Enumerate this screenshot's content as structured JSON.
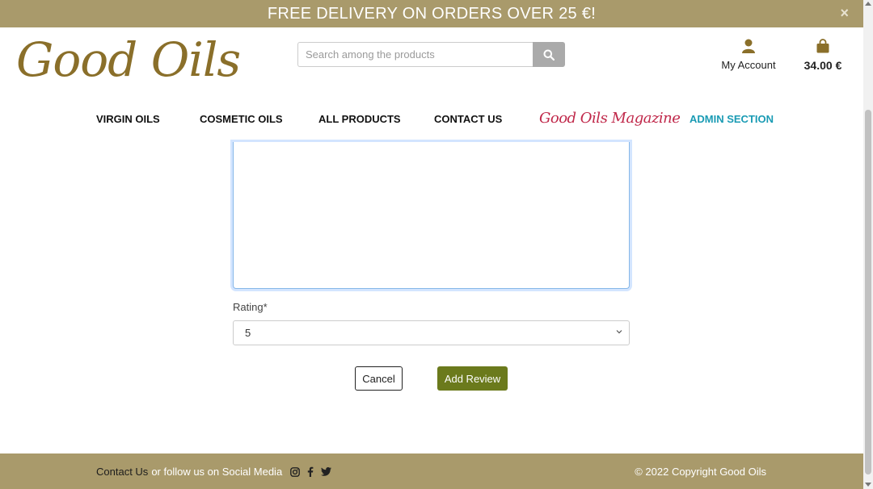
{
  "banner": {
    "text": "FREE DELIVERY ON ORDERS OVER 25 €!",
    "close_icon": "×"
  },
  "header": {
    "logo_text": "Good Oils",
    "search": {
      "placeholder": "Search among the products",
      "value": "",
      "button_icon": "search-icon"
    },
    "account": {
      "label": "My Account",
      "icon": "user-icon"
    },
    "cart": {
      "total": "34.00 €",
      "icon": "shopping-bag-icon"
    }
  },
  "nav": {
    "items": [
      {
        "label": "VIRGIN OILS"
      },
      {
        "label": "COSMETIC OILS"
      },
      {
        "label": "ALL PRODUCTS"
      },
      {
        "label": "CONTACT US"
      },
      {
        "label": "Good Oils Magazine"
      },
      {
        "label": "ADMIN SECTION"
      }
    ]
  },
  "form": {
    "review_text": "",
    "rating_label": "Rating*",
    "rating_value": "5",
    "cancel_label": "Cancel",
    "submit_label": "Add Review"
  },
  "footer": {
    "contact_link": "Contact Us",
    "follow_text": "or follow us on Social Media",
    "social_icons": [
      "instagram-icon",
      "facebook-icon",
      "twitter-icon"
    ],
    "copyright": "© 2022 Copyright Good Oils"
  },
  "colors": {
    "banner_bg": "#a99a6b",
    "logo": "#8a6f2a",
    "primary_button": "#6b7a1c",
    "magazine_link": "#c0284a",
    "admin_link": "#1a9bb4"
  }
}
